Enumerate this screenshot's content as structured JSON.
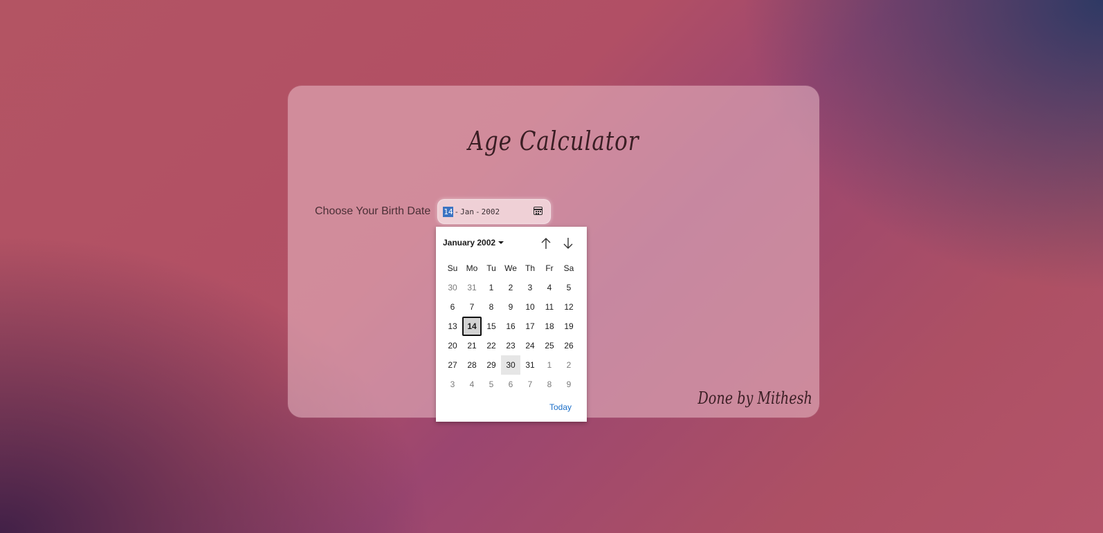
{
  "app": {
    "title": "Age Calculator",
    "signature": "Done by Mithesh"
  },
  "form": {
    "label": "Choose Your Birth Date",
    "date_value": {
      "day": "14",
      "month": "Jan",
      "year": "2002",
      "separator": "-"
    }
  },
  "picker": {
    "month_year": "January 2002",
    "weekdays": [
      "Su",
      "Mo",
      "Tu",
      "We",
      "Th",
      "Fr",
      "Sa"
    ],
    "weeks": [
      [
        {
          "d": "30",
          "o": true
        },
        {
          "d": "31",
          "o": true
        },
        {
          "d": "1"
        },
        {
          "d": "2"
        },
        {
          "d": "3"
        },
        {
          "d": "4"
        },
        {
          "d": "5"
        }
      ],
      [
        {
          "d": "6"
        },
        {
          "d": "7"
        },
        {
          "d": "8"
        },
        {
          "d": "9"
        },
        {
          "d": "10"
        },
        {
          "d": "11"
        },
        {
          "d": "12"
        }
      ],
      [
        {
          "d": "13"
        },
        {
          "d": "14",
          "sel": true
        },
        {
          "d": "15"
        },
        {
          "d": "16"
        },
        {
          "d": "17"
        },
        {
          "d": "18"
        },
        {
          "d": "19"
        }
      ],
      [
        {
          "d": "20"
        },
        {
          "d": "21"
        },
        {
          "d": "22"
        },
        {
          "d": "23"
        },
        {
          "d": "24"
        },
        {
          "d": "25"
        },
        {
          "d": "26"
        }
      ],
      [
        {
          "d": "27"
        },
        {
          "d": "28"
        },
        {
          "d": "29"
        },
        {
          "d": "30",
          "hov": true
        },
        {
          "d": "31"
        },
        {
          "d": "1",
          "o": true
        },
        {
          "d": "2",
          "o": true
        }
      ],
      [
        {
          "d": "3",
          "o": true
        },
        {
          "d": "4",
          "o": true
        },
        {
          "d": "5",
          "o": true
        },
        {
          "d": "6",
          "o": true
        },
        {
          "d": "7",
          "o": true
        },
        {
          "d": "8",
          "o": true
        },
        {
          "d": "9",
          "o": true
        }
      ]
    ],
    "today_label": "Today"
  },
  "colors": {
    "accent": "#3b73c2",
    "link": "#1a6ec8",
    "title_text": "#3a1e24"
  },
  "icons": {
    "calendar": "calendar-icon",
    "prev": "arrow-up-icon",
    "next": "arrow-down-icon",
    "dropdown": "caret-down-icon"
  }
}
